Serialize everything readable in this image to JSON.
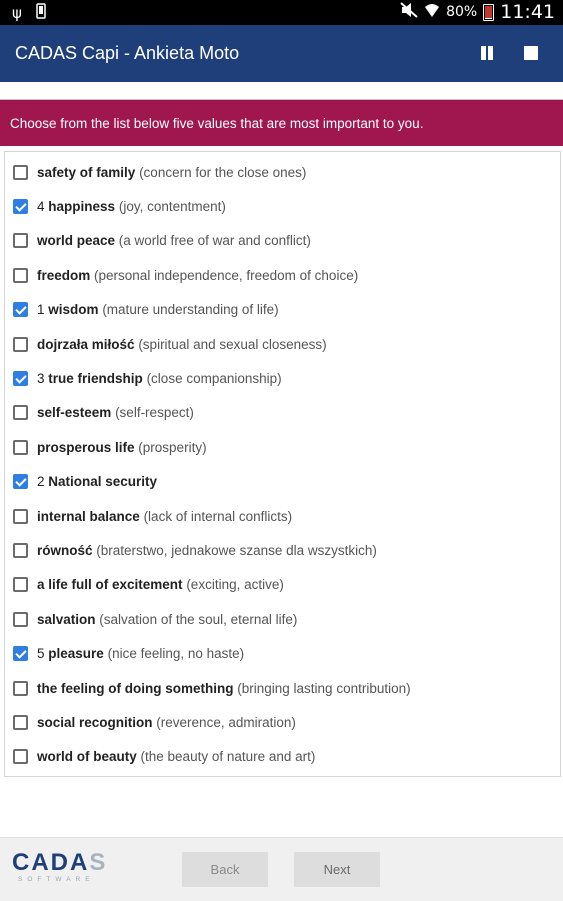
{
  "status_bar": {
    "icons": [
      "usb-icon",
      "phone-icon",
      "mute-icon",
      "wifi-icon"
    ],
    "battery_pct": "80%",
    "time": "11:41"
  },
  "app_bar": {
    "title": "CADAS Capi - Ankieta Moto",
    "pause_icon": "pause-icon",
    "stop_icon": "stop-icon",
    "background": "#1f3f7a"
  },
  "instruction": {
    "text": "Choose from the list below five values that are most important to you.",
    "background": "#a0174f"
  },
  "options": [
    {
      "checked": false,
      "prefix": "",
      "name": "safety of family",
      "desc": "(concern for the close ones)"
    },
    {
      "checked": true,
      "prefix": "4",
      "name": "happiness",
      "desc": "(joy, contentment)"
    },
    {
      "checked": false,
      "prefix": "",
      "name": "world peace",
      "desc": "(a world free of war and conflict)"
    },
    {
      "checked": false,
      "prefix": "",
      "name": "freedom",
      "desc": "(personal independence, freedom of choice)"
    },
    {
      "checked": true,
      "prefix": "1",
      "name": "wisdom",
      "desc": "(mature understanding of life)"
    },
    {
      "checked": false,
      "prefix": "",
      "name": "dojrzała miłość",
      "desc": "(spiritual and sexual closeness)"
    },
    {
      "checked": true,
      "prefix": "3",
      "name": "true friendship",
      "desc": "(close companionship)"
    },
    {
      "checked": false,
      "prefix": "",
      "name": "self-esteem",
      "desc": "(self-respect)"
    },
    {
      "checked": false,
      "prefix": "",
      "name": "prosperous life",
      "desc": "(prosperity)"
    },
    {
      "checked": true,
      "prefix": "2",
      "name": "National security",
      "desc": ""
    },
    {
      "checked": false,
      "prefix": "",
      "name": "internal balance",
      "desc": "(lack of internal conflicts)"
    },
    {
      "checked": false,
      "prefix": "",
      "name": "równość",
      "desc": "(braterstwo, jednakowe szanse dla wszystkich)"
    },
    {
      "checked": false,
      "prefix": "",
      "name": "a life full of excitement",
      "desc": "(exciting, active)"
    },
    {
      "checked": false,
      "prefix": "",
      "name": "salvation",
      "desc": "(salvation of the soul, eternal life)"
    },
    {
      "checked": true,
      "prefix": "5",
      "name": "pleasure",
      "desc": "(nice feeling, no haste)"
    },
    {
      "checked": false,
      "prefix": "",
      "name": "the feeling of doing something",
      "desc": "(bringing lasting contribution)"
    },
    {
      "checked": false,
      "prefix": "",
      "name": "social recognition",
      "desc": "(reverence, admiration)"
    },
    {
      "checked": false,
      "prefix": "",
      "name": "world of beauty",
      "desc": "(the beauty of nature and art)"
    }
  ],
  "footer": {
    "logo_main": "CADA",
    "logo_fade": "S",
    "logo_sub": "SOFTWARE",
    "back_label": "Back",
    "next_label": "Next"
  }
}
